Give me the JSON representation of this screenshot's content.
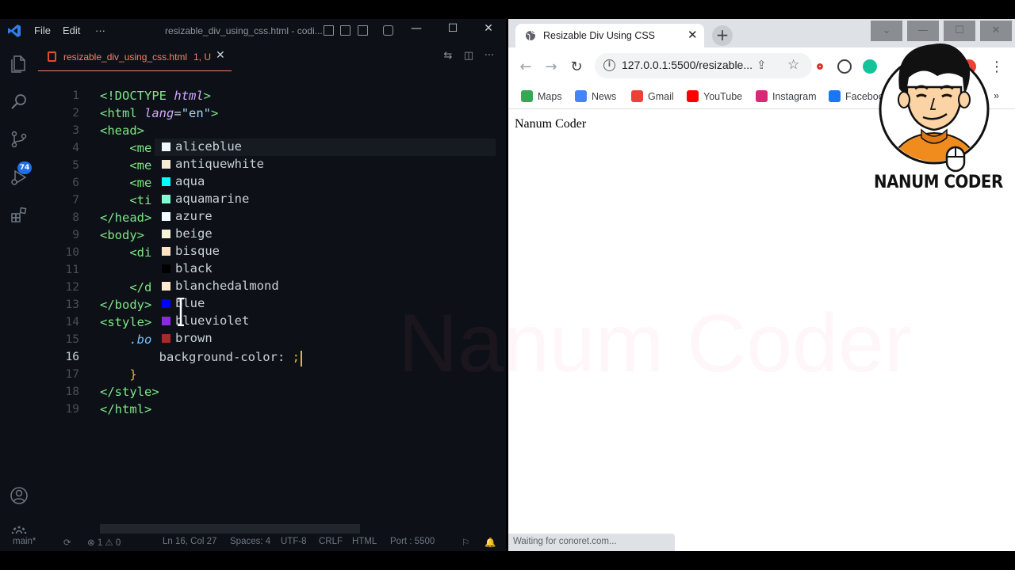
{
  "vscode": {
    "menu": [
      "File",
      "Edit",
      "···"
    ],
    "window_title": "resizable_div_using_css.html - codi...",
    "tab": {
      "name": "resizable_div_using_css.html",
      "status": "1, U"
    },
    "scm_badge": "74",
    "lines": [
      {
        "n": "1",
        "html": "<span class=\"tag\">&lt;!DOCTYPE</span> <span class=\"kw\">html</span><span class=\"tag\">&gt;</span>"
      },
      {
        "n": "2",
        "html": "<span class=\"tag\">&lt;html</span> <span class=\"attr\">lang</span>=<span class=\"str\">\"en\"</span><span class=\"tag\">&gt;</span>"
      },
      {
        "n": "3",
        "html": "<span class=\"tag\">&lt;head&gt;</span>"
      },
      {
        "n": "4",
        "html": "    <span class=\"tag\">&lt;me</span>"
      },
      {
        "n": "5",
        "html": "    <span class=\"tag\">&lt;me</span>"
      },
      {
        "n": "6",
        "html": "    <span class=\"tag\">&lt;me</span>"
      },
      {
        "n": "7",
        "html": "    <span class=\"tag\">&lt;ti</span>"
      },
      {
        "n": "8",
        "html": "<span class=\"tag\">&lt;/head&gt;</span>"
      },
      {
        "n": "9",
        "html": "<span class=\"tag\">&lt;body&gt;</span>"
      },
      {
        "n": "10",
        "html": "    <span class=\"tag\">&lt;di</span>"
      },
      {
        "n": "11",
        "html": ""
      },
      {
        "n": "12",
        "html": "    <span class=\"tag\">&lt;/d</span>"
      },
      {
        "n": "13",
        "html": "<span class=\"tag\">&lt;/body&gt;</span>"
      },
      {
        "n": "14",
        "html": "<span class=\"tag\">&lt;style&gt;</span>"
      },
      {
        "n": "15",
        "html": "    <span class=\"sel\">.bo</span>"
      },
      {
        "n": "16",
        "html": "        <span class=\"prop\">background-color:</span> <span class=\"brace\">;</span>"
      },
      {
        "n": "17",
        "html": "    <span class=\"brace\">}</span>"
      },
      {
        "n": "18",
        "html": "<span class=\"tag\">&lt;/style&gt;</span>"
      },
      {
        "n": "19",
        "html": "<span class=\"tag\">&lt;/html&gt;</span>"
      }
    ],
    "suggestions": [
      {
        "label": "aliceblue",
        "color": "#f0f8ff"
      },
      {
        "label": "antiquewhite",
        "color": "#faebd7"
      },
      {
        "label": "aqua",
        "color": "#00ffff"
      },
      {
        "label": "aquamarine",
        "color": "#7fffd4"
      },
      {
        "label": "azure",
        "color": "#f0ffff"
      },
      {
        "label": "beige",
        "color": "#f5f5dc"
      },
      {
        "label": "bisque",
        "color": "#ffe4c4"
      },
      {
        "label": "black",
        "color": "#000000"
      },
      {
        "label": "blanchedalmond",
        "color": "#ffebcd"
      },
      {
        "label": "blue",
        "color": "#0000ff"
      },
      {
        "label": "blueviolet",
        "color": "#8a2be2"
      },
      {
        "label": "brown",
        "color": "#a52a2a"
      }
    ],
    "status": {
      "branch": "main*",
      "problems": "⊗ 1 ⚠ 0",
      "position": "Ln 16, Col 27",
      "spaces": "Spaces: 4",
      "encoding": "UTF-8",
      "eol": "CRLF",
      "language": "HTML",
      "port": "Port : 5500"
    }
  },
  "chrome": {
    "tab_title": "Resizable Div Using CSS",
    "url": "127.0.0.1:5500/resizable...",
    "bookmarks": [
      {
        "label": "Maps",
        "color": "#34a853"
      },
      {
        "label": "News",
        "color": "#4285f4"
      },
      {
        "label": "Gmail",
        "color": "#ea4335"
      },
      {
        "label": "YouTube",
        "color": "#ff0000"
      },
      {
        "label": "Instagram",
        "color": "#d62976"
      },
      {
        "label": "Faceboo",
        "color": "#1877f2"
      }
    ],
    "page_text": "Nanum Coder",
    "watermark": "Nanum Coder",
    "status_text": "Waiting for conoret.com..."
  },
  "logo": {
    "brand": "NANUM CODER"
  }
}
